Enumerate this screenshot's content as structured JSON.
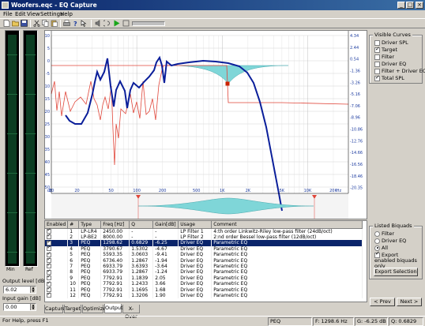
{
  "window": {
    "title": "Woofers.eqc - EQ Capture",
    "minimize": "_",
    "maximize": "□",
    "close": "×"
  },
  "menu": [
    "File",
    "Edit",
    "View",
    "Settings",
    "Help"
  ],
  "meters": {
    "left_label": "Min",
    "right_label": "Ref"
  },
  "output_level": {
    "label": "Output level [dB]",
    "value": "6.02"
  },
  "input_gain": {
    "label": "Input gain [dB]",
    "value": "0.00"
  },
  "graph": {
    "y_left_ticks": [
      "10",
      "5",
      "0",
      "-5",
      "-10",
      "-15",
      "-20",
      "-25",
      "-30",
      "-35",
      "-40",
      "-45",
      "-50"
    ],
    "y_right_ticks": [
      "-20.35",
      "-18.46",
      "-16.56",
      "-14.66",
      "-12.76",
      "-10.86",
      "-8.96",
      "-7.06",
      "-5.16",
      "-3.26",
      "-1.36",
      "0.54",
      "2.44",
      "4.34"
    ],
    "x_ticks": [
      "dB",
      "10",
      "20",
      "50",
      "100",
      "200",
      "500",
      "1K",
      "2K",
      "5K",
      "10K",
      "20K",
      "Hz"
    ]
  },
  "colors": {
    "total_spl": "#0a1e9a",
    "target": "#e0463a",
    "filter_fill": "#7fd6d8",
    "marker": "#cc2200"
  },
  "visible_curves": {
    "title": "Visible Curves",
    "items": [
      {
        "label": "Driver SPL",
        "checked": false
      },
      {
        "label": "Target",
        "checked": true
      },
      {
        "label": "Filter",
        "checked": false
      },
      {
        "label": "Driver EQ",
        "checked": false
      },
      {
        "label": "Filter + Driver EQ",
        "checked": false
      },
      {
        "label": "Total SPL",
        "checked": true
      }
    ]
  },
  "listed_biquads": {
    "title": "Listed Biquads",
    "options": [
      {
        "label": "Filter",
        "selected": false
      },
      {
        "label": "Driver EQ",
        "selected": false
      },
      {
        "label": "All",
        "selected": true
      }
    ],
    "export_label": "Export enabled biquads only",
    "export_checked": true,
    "export_button": "Export Selection"
  },
  "table": {
    "headers": [
      "Enabled",
      "#",
      "Type",
      "Freq [Hz]",
      "Q",
      "Gain[dB]",
      "Usage",
      "Comment"
    ],
    "rows": [
      [
        "1",
        "LP-LR4",
        "2450.00",
        "-",
        "-",
        "LP Filter 1",
        "4:th order Linkwitz-Riley low-pass filter (24dB/oct)"
      ],
      [
        "2",
        "LP-BE2",
        "8000.00",
        "-",
        "-",
        "LP Filter 2",
        "2:nd order Bessel low-pass filter (12dB/oct)"
      ],
      [
        "3",
        "PEQ",
        "1298.62",
        "0.6829",
        "-6.25",
        "Driver EQ",
        "Parametric EQ"
      ],
      [
        "4",
        "PEQ",
        "3790.67",
        "1.5302",
        "-4.67",
        "Driver EQ",
        "Parametric EQ"
      ],
      [
        "5",
        "PEQ",
        "5593.35",
        "3.0603",
        "-9.41",
        "Driver EQ",
        "Parametric EQ"
      ],
      [
        "6",
        "PEQ",
        "6736.40",
        "1.2867",
        "-1.94",
        "Driver EQ",
        "Parametric EQ"
      ],
      [
        "7",
        "PEQ",
        "6933.79",
        "3.6393",
        "-3.64",
        "Driver EQ",
        "Parametric EQ"
      ],
      [
        "8",
        "PEQ",
        "6933.79",
        "1.2867",
        "-1.24",
        "Driver EQ",
        "Parametric EQ"
      ],
      [
        "9",
        "PEQ",
        "7792.91",
        "1.1839",
        "2.05",
        "Driver EQ",
        "Parametric EQ"
      ],
      [
        "10",
        "PEQ",
        "7792.91",
        "1.2433",
        "3.66",
        "Driver EQ",
        "Parametric EQ"
      ],
      [
        "11",
        "PEQ",
        "7792.91",
        "1.1695",
        "1.68",
        "Driver EQ",
        "Parametric EQ"
      ],
      [
        "12",
        "PEQ",
        "7792.91",
        "1.3206",
        "1.90",
        "Driver EQ",
        "Parametric EQ"
      ]
    ],
    "selected_index": 2
  },
  "nav": {
    "prev": "< Prev",
    "next": "Next >"
  },
  "tabs": [
    {
      "label": "Capture",
      "active": false
    },
    {
      "label": "Target",
      "active": false
    },
    {
      "label": "Optimizer",
      "active": false
    },
    {
      "label": "Output",
      "active": true
    },
    {
      "label": "X-Over",
      "active": false
    }
  ],
  "status": {
    "help": "For Help, press F1",
    "type": "PEQ",
    "freq": "F: 1298.6 Hz",
    "gain": "G: -6.25 dB",
    "q": "Q: 0.6829"
  }
}
